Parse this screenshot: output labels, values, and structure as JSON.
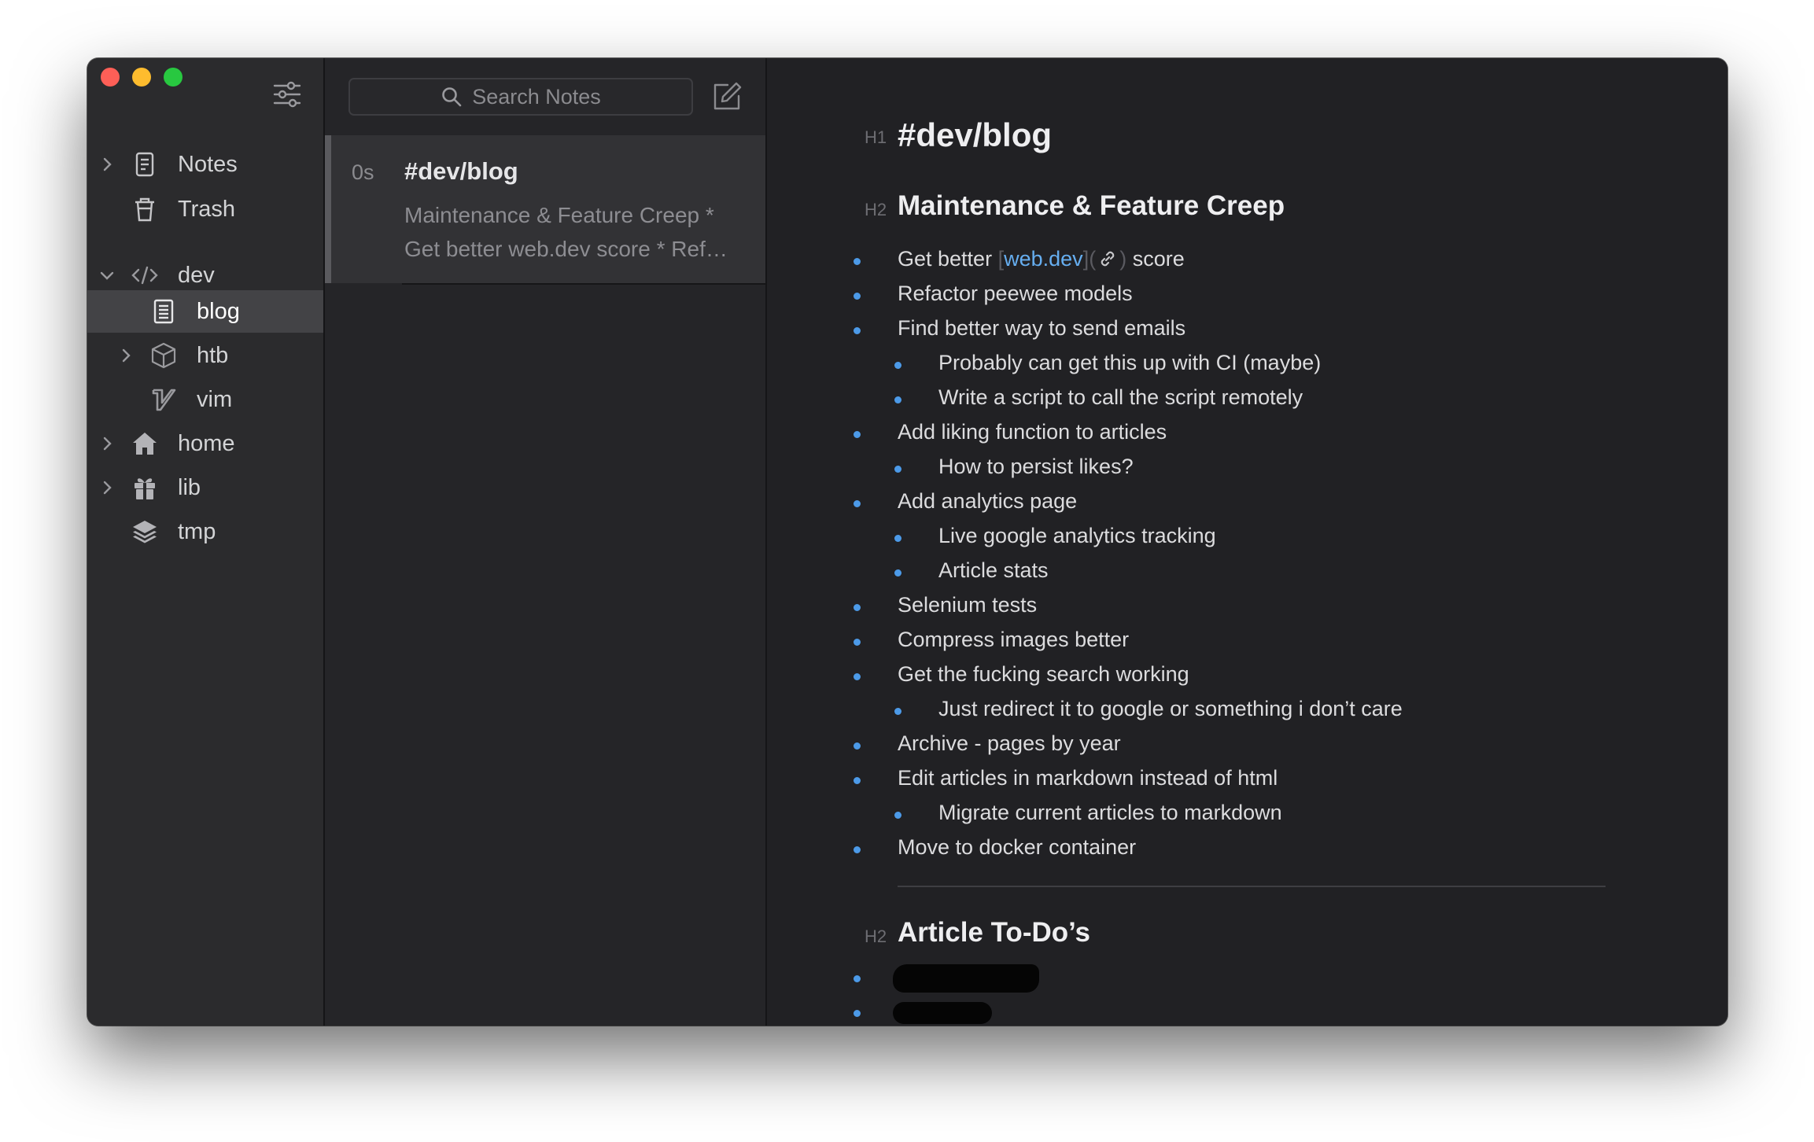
{
  "sidebar": {
    "items": [
      {
        "label": "Notes",
        "icon": "note-icon"
      },
      {
        "label": "Trash",
        "icon": "trash-icon"
      },
      {
        "label": "dev",
        "icon": "code-icon"
      },
      {
        "label": "blog",
        "icon": "document-icon"
      },
      {
        "label": "htb",
        "icon": "cube-icon"
      },
      {
        "label": "vim",
        "icon": "vim-icon"
      },
      {
        "label": "home",
        "icon": "home-icon"
      },
      {
        "label": "lib",
        "icon": "gift-icon"
      },
      {
        "label": "tmp",
        "icon": "layers-icon"
      }
    ]
  },
  "notelist": {
    "search_placeholder": "Search Notes",
    "note": {
      "time": "0s",
      "title": "#dev/blog",
      "excerpt_line1": "Maintenance & Feature Creep *",
      "excerpt_line2": "Get better web.dev score * Ref…"
    }
  },
  "editor": {
    "h1_marker": "H1",
    "h2_marker": "H2",
    "title": "#dev/blog",
    "section1": {
      "heading": "Maintenance & Feature Creep",
      "item0_before": "Get better",
      "item0_link_open": "[",
      "item0_link_text": "web.dev",
      "item0_link_close": "](",
      "item0_link_end": ")",
      "item0_after": "score",
      "items": [
        "Refactor peewee models",
        "Find better way to send emails",
        "Probably can get this up with CI (maybe)",
        "Write a script to call the script remotely",
        "Add liking function to articles",
        "How to persist likes?",
        "Add analytics page",
        "Live google analytics tracking",
        "Article stats",
        "Selenium tests",
        "Compress images better",
        "Get the fucking search working",
        "Just redirect it to google or something i don’t care",
        "Archive - pages by year",
        "Edit articles in markdown instead of html",
        "Migrate current articles to markdown",
        "Move to docker container"
      ]
    },
    "section2": {
      "heading": "Article To-Do’s"
    }
  },
  "colors": {
    "accent": "#4c9ae8",
    "link": "#66aef0",
    "close": "#fe5f57",
    "minimize": "#febc2e",
    "maximize": "#28c840"
  }
}
